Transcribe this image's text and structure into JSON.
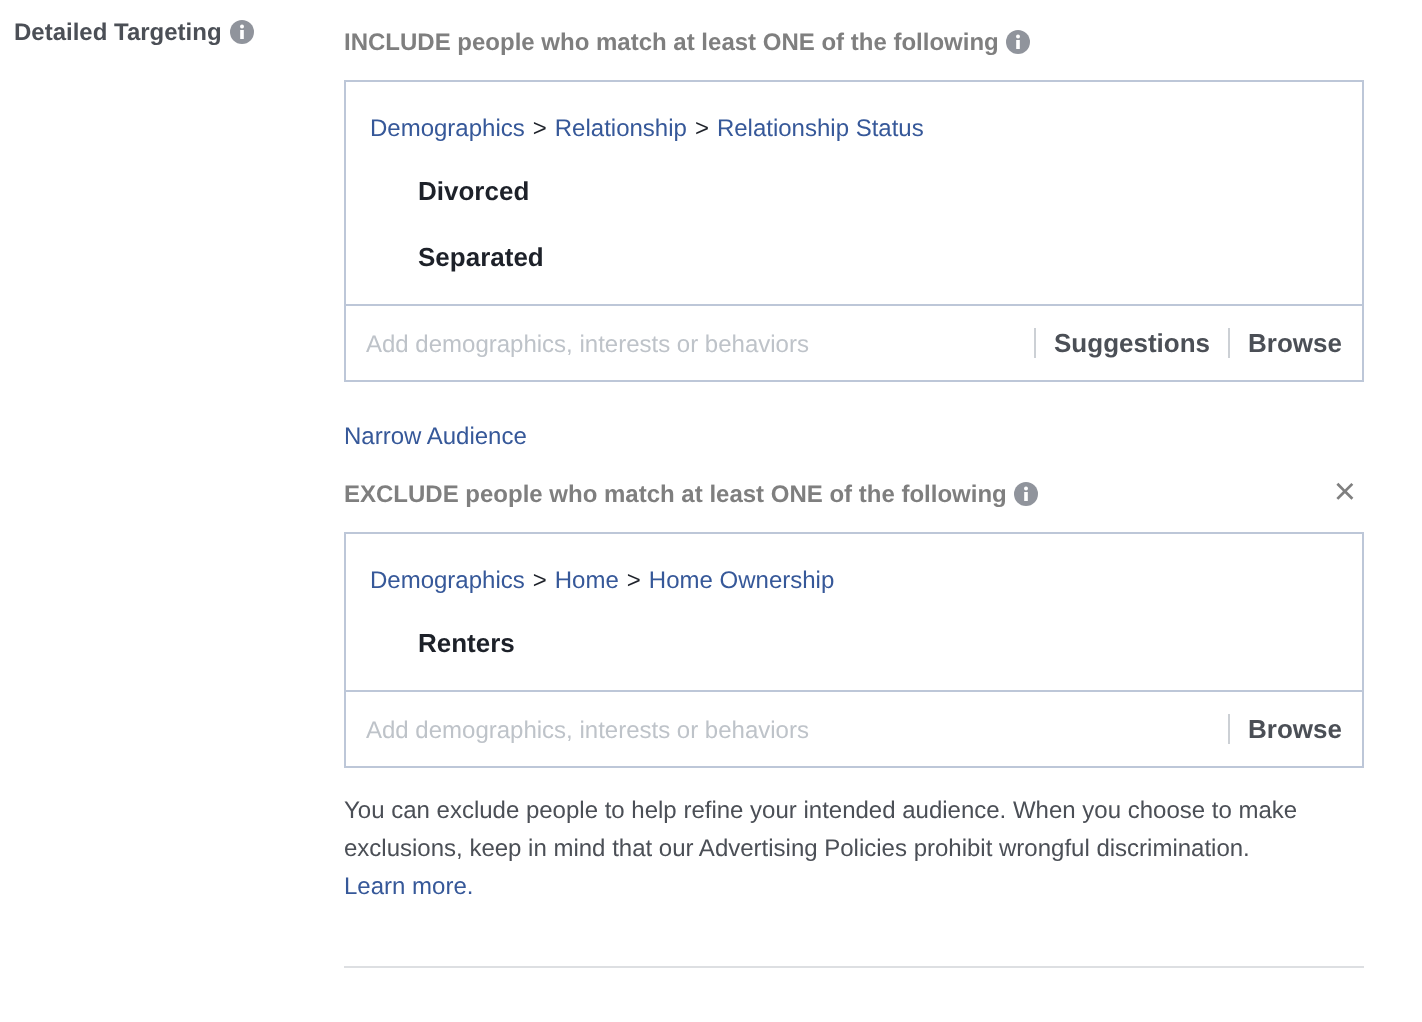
{
  "label": "Detailed Targeting",
  "include": {
    "heading": "INCLUDE people who match at least ONE of the following",
    "groups": [
      {
        "path": [
          "Demographics",
          "Relationship",
          "Relationship Status"
        ],
        "separator": ">",
        "items": [
          "Divorced",
          "Separated"
        ]
      }
    ],
    "placeholder": "Add demographics, interests or behaviors",
    "actions": [
      "Suggestions",
      "Browse"
    ]
  },
  "narrow_link": "Narrow Audience",
  "exclude": {
    "heading": "EXCLUDE people who match at least ONE of the following",
    "close": "×",
    "groups": [
      {
        "path": [
          "Demographics",
          "Home",
          "Home Ownership"
        ],
        "separator": ">",
        "items": [
          "Renters"
        ]
      }
    ],
    "placeholder": "Add demographics, interests or behaviors",
    "actions": [
      "Browse"
    ]
  },
  "note": {
    "text": "You can exclude people to help refine your intended audience. When you choose to make exclusions, keep in mind that our Advertising Policies prohibit wrongful discrimination.",
    "link": "Learn more."
  }
}
